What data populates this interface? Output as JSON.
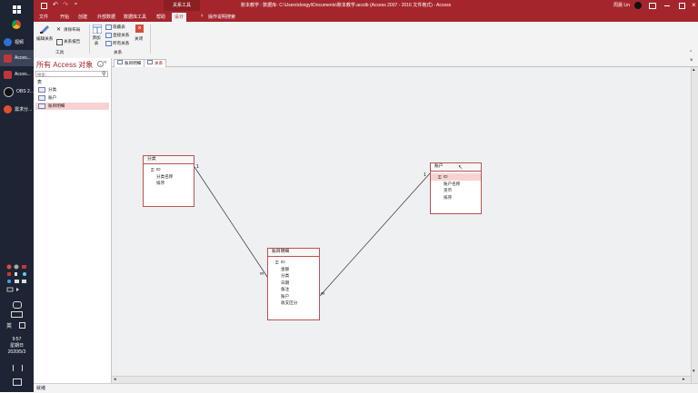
{
  "taskbar": {
    "items": [
      {
        "label": "视频",
        "color": "#2f6fd6"
      },
      {
        "label": "Acces...",
        "color": "#c0373b"
      },
      {
        "label": "Acces...",
        "color": "#c0373b"
      },
      {
        "label": "OBS 2...",
        "color": "#3a3a3a"
      },
      {
        "label": "需求分...",
        "color": "#e05030"
      }
    ],
    "ime": "英",
    "time": "9:57",
    "weekday": "星期日",
    "date": "2020/5/3"
  },
  "titlebar": {
    "context_tab": "关系工具",
    "title": "账本教学 : 数据库- C:\\Users\\dongyl\\Documents\\账本教学.accdb (Access 2007 - 2016 文件格式) - Access",
    "user": "周晨 Lin"
  },
  "menu_tabs": [
    "文件",
    "开始",
    "创建",
    "外部数据",
    "数据库工具",
    "帮助",
    "设计",
    "操作说明搜索"
  ],
  "ribbon": {
    "edit_relationships": "编辑关系",
    "clear_layout": "清除布局",
    "relationship_report": "关系报告",
    "group_tools": "工具",
    "add_tables": "添加表",
    "hide_table": "隐藏表",
    "direct_relationships": "直接关系",
    "all_relationships": "所有关系",
    "close": "关闭",
    "group_relationships": "关系"
  },
  "nav": {
    "title": "所有 Access 对象",
    "search_placeholder": "搜索...",
    "section": "表",
    "items": [
      "分类",
      "账户",
      "账目明细"
    ]
  },
  "doc_tabs": [
    "账目明细",
    "关系"
  ],
  "tables": {
    "category": {
      "title": "分类",
      "fields": [
        "ID",
        "分类名称",
        "排序"
      ]
    },
    "account": {
      "title": "账户",
      "fields": [
        "ID",
        "账户名称",
        "货币",
        "排序"
      ]
    },
    "details": {
      "title": "账目明细",
      "fields": [
        "ID",
        "金额",
        "分类",
        "日期",
        "备注",
        "账户",
        "收支区分"
      ]
    }
  },
  "relationships": {
    "one": "1",
    "many": "∞"
  },
  "status": "就绪"
}
